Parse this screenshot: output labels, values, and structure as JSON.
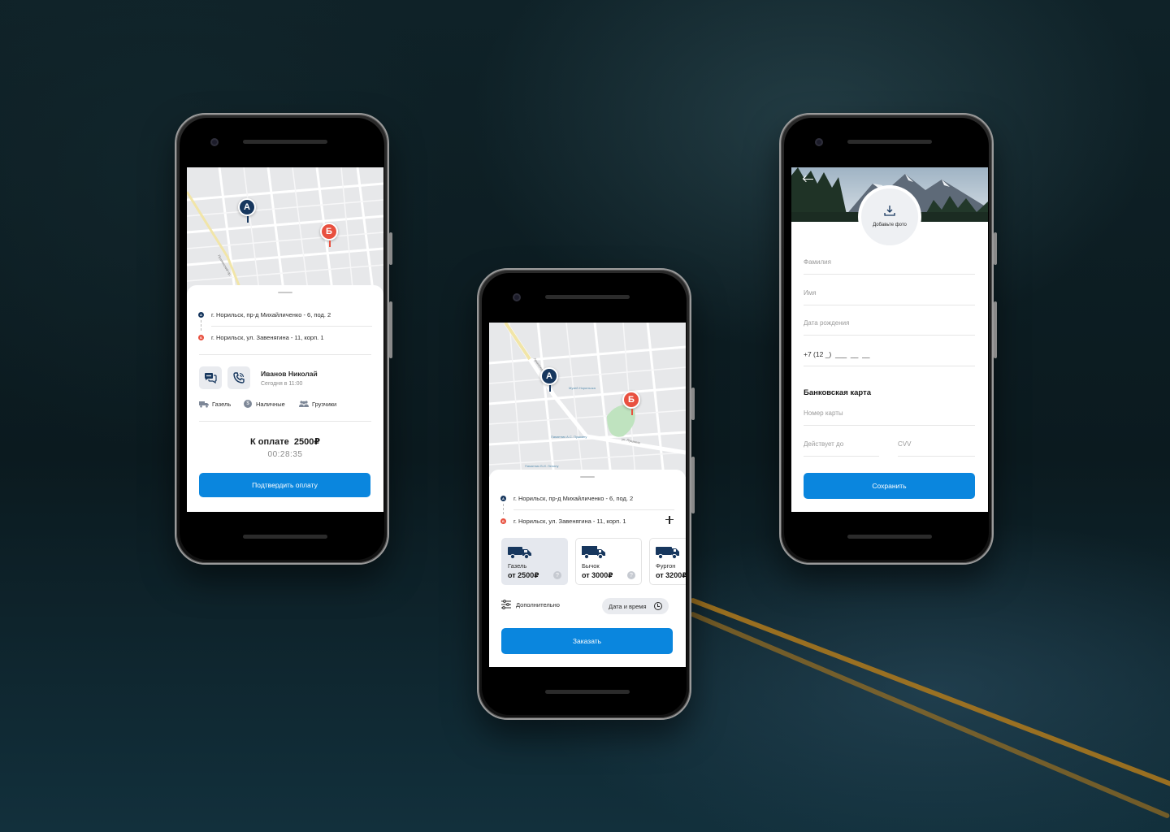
{
  "colors": {
    "accent": "#0a86de",
    "pin_a": "#17375e",
    "pin_b": "#e8503f",
    "map": "#e7e8ea"
  },
  "common": {
    "pin_a_letter": "A",
    "pin_b_letter": "Б",
    "address_a": "г. Норильск, пр-д Михайличенко - 6, под. 2",
    "address_b": "г. Норильск, ул. Завенягина - 11, корп. 1"
  },
  "payment_screen": {
    "street_label": "Пушкинский пр.",
    "driver_name": "Иванов Николай",
    "driver_time": "Сегодня в 11:00",
    "chat_icon": "chat-bubbles-icon",
    "call_icon": "phone-call-icon",
    "tags": [
      {
        "icon": "truck-icon",
        "label": "Газель"
      },
      {
        "icon": "coin-icon",
        "label": "Наличные"
      },
      {
        "icon": "people-icon",
        "label": "Грузчики"
      }
    ],
    "total_label": "К оплате  2500₽",
    "timer": "00:28:35",
    "confirm_button": "Подтвердить оплату"
  },
  "order_screen": {
    "map_labels": {
      "museum": "Музей Норильска",
      "monument_pushkin": "Памятник А.С. Пушкину",
      "street_pushkin": "ул. Пушкина",
      "monument_lenin": "Памятник В.И. Ленину",
      "street_side": "Ленинский пр."
    },
    "add_icon": "plus-icon",
    "vehicles": [
      {
        "name": "Газель",
        "price": "от 2500₽",
        "active": true
      },
      {
        "name": "Бычок",
        "price": "от 3000₽",
        "active": false
      },
      {
        "name": "Фургон",
        "price": "от 3200₽",
        "active": false
      }
    ],
    "question_mark": "?",
    "extra_label": "Дополнительно",
    "datetime_label": "Дата и время",
    "order_button": "Заказать"
  },
  "profile_screen": {
    "back_icon": "arrow-left-icon",
    "add_photo_label": "Добавьте фото",
    "fields": {
      "surname": "Фамилия",
      "name": "Имя",
      "birthdate": "Дата рождения",
      "phone": "+7 (12 _)  ___  __  __"
    },
    "bank_card_title": "Банковская карта",
    "card_number": "Номер карты",
    "valid_until": "Действует до",
    "cvv": "CVV",
    "save_button": "Сохранить"
  }
}
